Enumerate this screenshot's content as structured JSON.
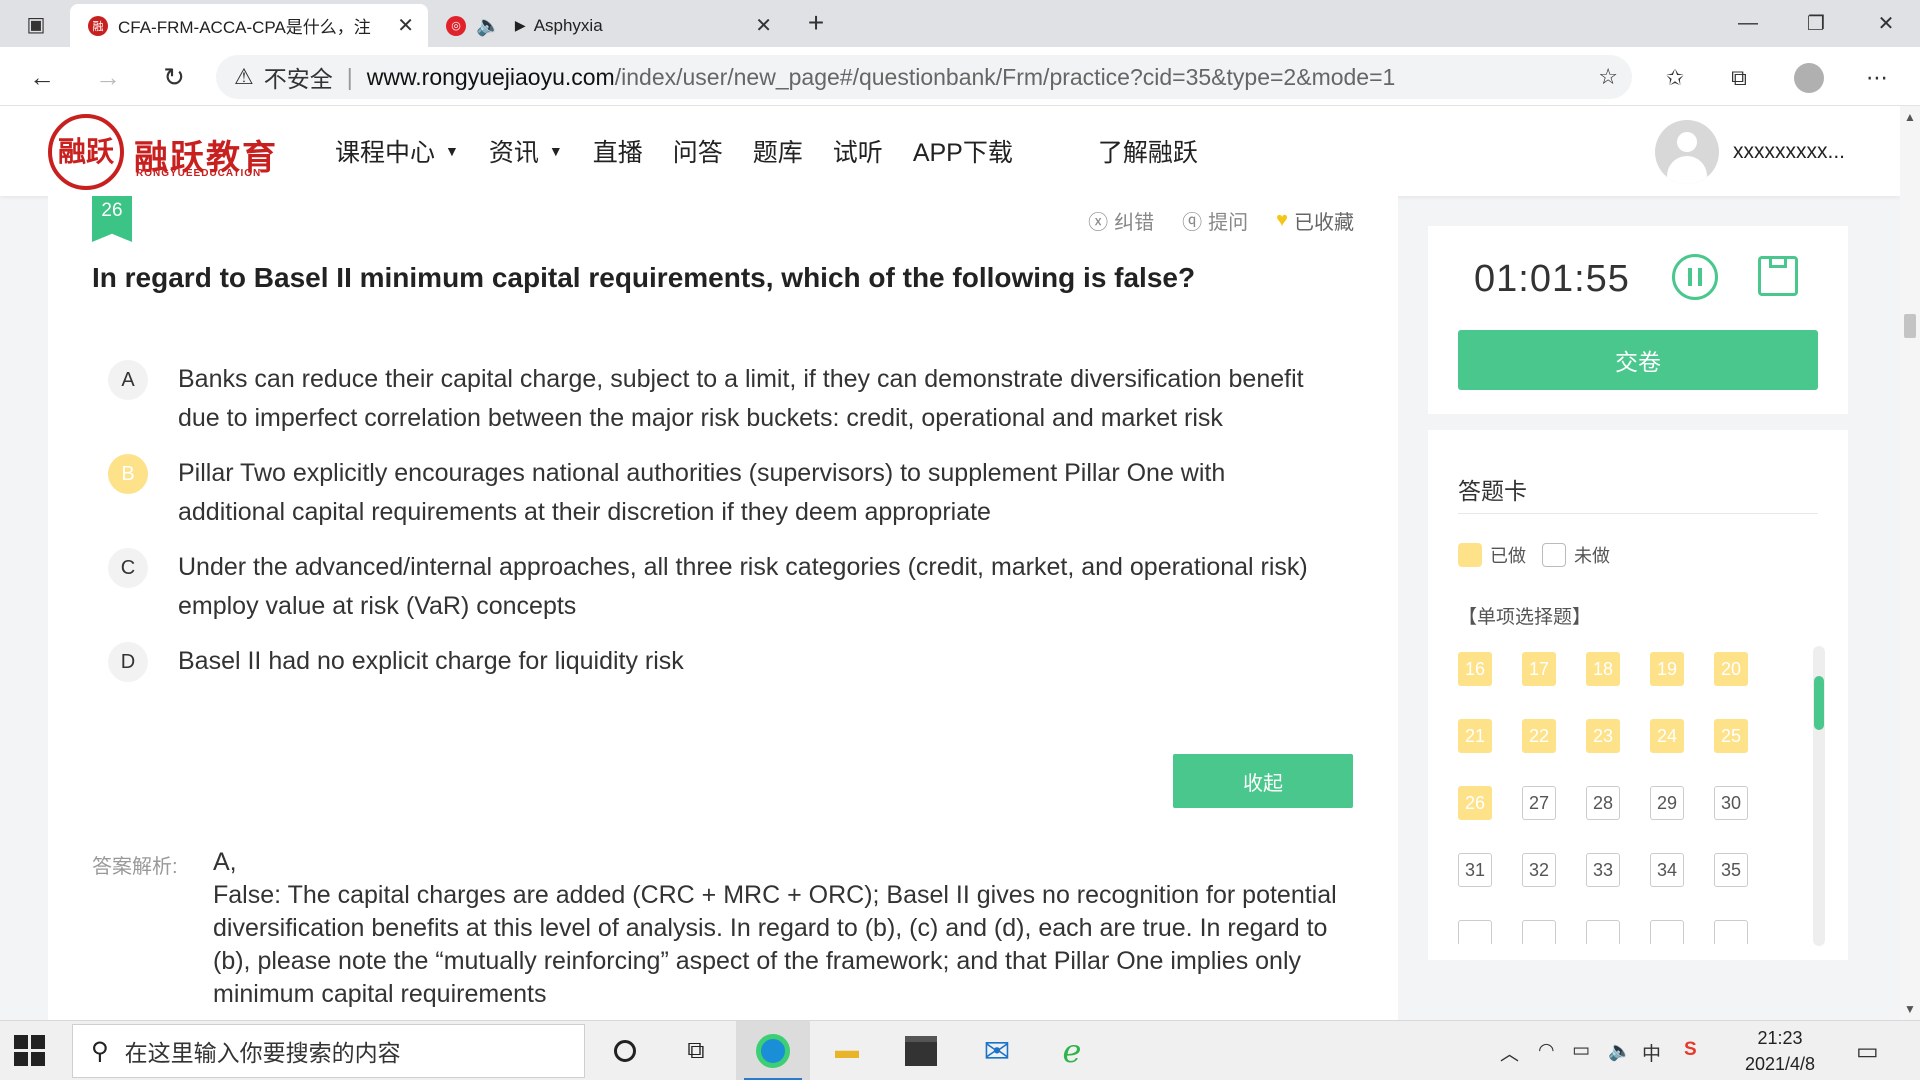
{
  "browser": {
    "tabs": [
      {
        "title": "CFA-FRM-ACCA-CPA是什么，注",
        "active": true
      },
      {
        "title": "Asphyxia",
        "active": false
      }
    ],
    "address": {
      "security": "不安全",
      "host": "www.rongyuejiaoyu.com",
      "path": "/index/user/new_page#/questionbank/Frm/practice?cid=35&type=2&mode=1"
    }
  },
  "site": {
    "logo_seal": "融跃",
    "logo_text": "融跃教育",
    "logo_sub": "RONGYUEEDUCATION",
    "nav": [
      "课程中心",
      "资讯",
      "直播",
      "问答",
      "题库",
      "试听",
      "APP下载",
      "了解融跃"
    ],
    "username": "xxxxxxxxx..."
  },
  "question": {
    "number": "26",
    "tools": {
      "report": "纠错",
      "ask": "提问",
      "favorite": "已收藏"
    },
    "text": "In regard to Basel II minimum capital requirements, which of the following is false?",
    "options": [
      {
        "letter": "A",
        "text": "Banks can reduce their capital charge, subject to a limit, if they can demonstrate diversification benefit due to imperfect correlation between the major risk buckets: credit, operational and market risk",
        "selected": false
      },
      {
        "letter": "B",
        "text": "Pillar Two explicitly encourages national authorities (supervisors) to supplement Pillar One with additional capital requirements at their discretion if they deem appropriate",
        "selected": true
      },
      {
        "letter": "C",
        "text": "Under the advanced/internal approaches, all three risk categories (credit, market, and operational risk) employ value at risk (VaR) concepts",
        "selected": false
      },
      {
        "letter": "D",
        "text": "Basel II had no explicit charge for liquidity risk",
        "selected": false
      }
    ],
    "collapse_label": "收起",
    "analysis_label": "答案解析:",
    "analysis_answer": "A,",
    "analysis_text": "False: The capital charges are added (CRC + MRC + ORC); Basel II gives no recognition for potential diversification benefits at this level of analysis. In regard to (b), (c) and (d), each are true. In regard to (b), please note the “mutually reinforcing” aspect of the framework; and that Pillar One implies only minimum capital requirements"
  },
  "timer": {
    "value": "01:01:55",
    "submit_label": "交卷"
  },
  "answer_card": {
    "title": "答题卡",
    "legend_done": "已做",
    "legend_todo": "未做",
    "section": "【单项选择题】",
    "cells": [
      {
        "n": "16",
        "done": true
      },
      {
        "n": "17",
        "done": true
      },
      {
        "n": "18",
        "done": true
      },
      {
        "n": "19",
        "done": true
      },
      {
        "n": "20",
        "done": true
      },
      {
        "n": "21",
        "done": true
      },
      {
        "n": "22",
        "done": true
      },
      {
        "n": "23",
        "done": true
      },
      {
        "n": "24",
        "done": true
      },
      {
        "n": "25",
        "done": true
      },
      {
        "n": "26",
        "done": true
      },
      {
        "n": "27",
        "done": false
      },
      {
        "n": "28",
        "done": false
      },
      {
        "n": "29",
        "done": false
      },
      {
        "n": "30",
        "done": false
      },
      {
        "n": "31",
        "done": false
      },
      {
        "n": "32",
        "done": false
      },
      {
        "n": "33",
        "done": false
      },
      {
        "n": "34",
        "done": false
      },
      {
        "n": "35",
        "done": false
      },
      {
        "n": "",
        "done": false
      },
      {
        "n": "",
        "done": false
      },
      {
        "n": "",
        "done": false
      },
      {
        "n": "",
        "done": false
      },
      {
        "n": "",
        "done": false
      }
    ]
  },
  "taskbar": {
    "search_placeholder": "在这里输入你要搜索的内容",
    "ime": "中",
    "time": "21:23",
    "date": "2021/4/8"
  }
}
